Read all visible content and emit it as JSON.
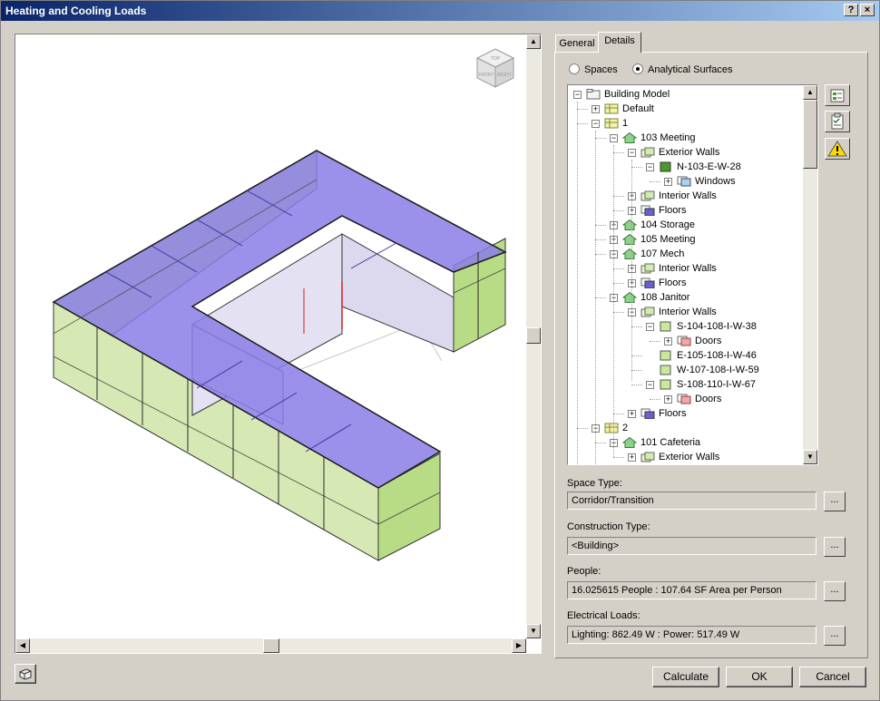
{
  "window": {
    "title": "Heating and Cooling Loads",
    "help_glyph": "?",
    "close_glyph": "×"
  },
  "viewcube": {
    "face_top": "TOP",
    "face_front": "FRONT",
    "face_right": "RIGHT"
  },
  "tabs": [
    {
      "label": "General",
      "active": false
    },
    {
      "label": "Details",
      "active": true
    }
  ],
  "view_mode": {
    "options": [
      {
        "label": "Spaces",
        "selected": false
      },
      {
        "label": "Analytical Surfaces",
        "selected": true
      }
    ]
  },
  "tree": [
    {
      "label": "Building Model",
      "level": 0,
      "icon": "folder-icon",
      "expander": "minus"
    },
    {
      "label": "Default",
      "level": 1,
      "icon": "level-icon",
      "expander": "plus"
    },
    {
      "label": "1",
      "level": 1,
      "icon": "level-icon",
      "expander": "minus"
    },
    {
      "label": "103 Meeting",
      "level": 2,
      "icon": "space-icon",
      "expander": "minus"
    },
    {
      "label": "Exterior Walls",
      "level": 3,
      "icon": "walls-icon",
      "expander": "minus"
    },
    {
      "label": "N-103-E-W-28",
      "level": 4,
      "icon": "surface-dark-icon",
      "expander": "minus"
    },
    {
      "label": "Windows",
      "level": 5,
      "icon": "windows-icon",
      "expander": "plus"
    },
    {
      "label": "Interior Walls",
      "level": 3,
      "icon": "walls-icon",
      "expander": "plus"
    },
    {
      "label": "Floors",
      "level": 3,
      "icon": "floors-icon",
      "expander": "plus"
    },
    {
      "label": "104 Storage",
      "level": 2,
      "icon": "space-icon",
      "expander": "plus"
    },
    {
      "label": "105 Meeting",
      "level": 2,
      "icon": "space-icon",
      "expander": "plus"
    },
    {
      "label": "107 Mech",
      "level": 2,
      "icon": "space-icon",
      "expander": "minus"
    },
    {
      "label": "Interior Walls",
      "level": 3,
      "icon": "walls-icon",
      "expander": "plus"
    },
    {
      "label": "Floors",
      "level": 3,
      "icon": "floors-icon",
      "expander": "plus"
    },
    {
      "label": "108 Janitor",
      "level": 2,
      "icon": "space-icon",
      "expander": "minus"
    },
    {
      "label": "Interior Walls",
      "level": 3,
      "icon": "walls-icon",
      "expander": "minus"
    },
    {
      "label": "S-104-108-I-W-38",
      "level": 4,
      "icon": "surface-light-icon",
      "expander": "minus"
    },
    {
      "label": "Doors",
      "level": 5,
      "icon": "doors-icon",
      "expander": "plus"
    },
    {
      "label": "E-105-108-I-W-46",
      "level": 4,
      "icon": "surface-light-icon",
      "expander": "none"
    },
    {
      "label": "W-107-108-I-W-59",
      "level": 4,
      "icon": "surface-light-icon",
      "expander": "none"
    },
    {
      "label": "S-108-110-I-W-67",
      "level": 4,
      "icon": "surface-light-icon",
      "expander": "minus"
    },
    {
      "label": "Doors",
      "level": 5,
      "icon": "doors-icon",
      "expander": "plus"
    },
    {
      "label": "Floors",
      "level": 3,
      "icon": "floors-icon",
      "expander": "plus"
    },
    {
      "label": "2",
      "level": 1,
      "icon": "level-icon",
      "expander": "minus"
    },
    {
      "label": "101 Cafeteria",
      "level": 2,
      "icon": "space-icon",
      "expander": "minus"
    },
    {
      "label": "Exterior Walls",
      "level": 3,
      "icon": "walls-icon",
      "expander": "plus"
    }
  ],
  "fields": {
    "space_type": {
      "label": "Space Type:",
      "value": "Corridor/Transition"
    },
    "construction_type": {
      "label": "Construction Type:",
      "value": "<Building>"
    },
    "people": {
      "label": "People:",
      "value": "16.025615 People :  107.64 SF Area per Person"
    },
    "electrical_loads": {
      "label": "Electrical Loads:",
      "value": "Lighting: 862.49 W : Power: 517.49 W"
    },
    "browse_label": "..."
  },
  "buttons": {
    "calculate": "Calculate",
    "ok": "OK",
    "cancel": "Cancel"
  },
  "colors": {
    "title_start": "#0a246a",
    "title_end": "#a6caf0",
    "roof": "#6a5fd8",
    "glass": "#b8e07a",
    "frame": "#2a2a2a"
  }
}
